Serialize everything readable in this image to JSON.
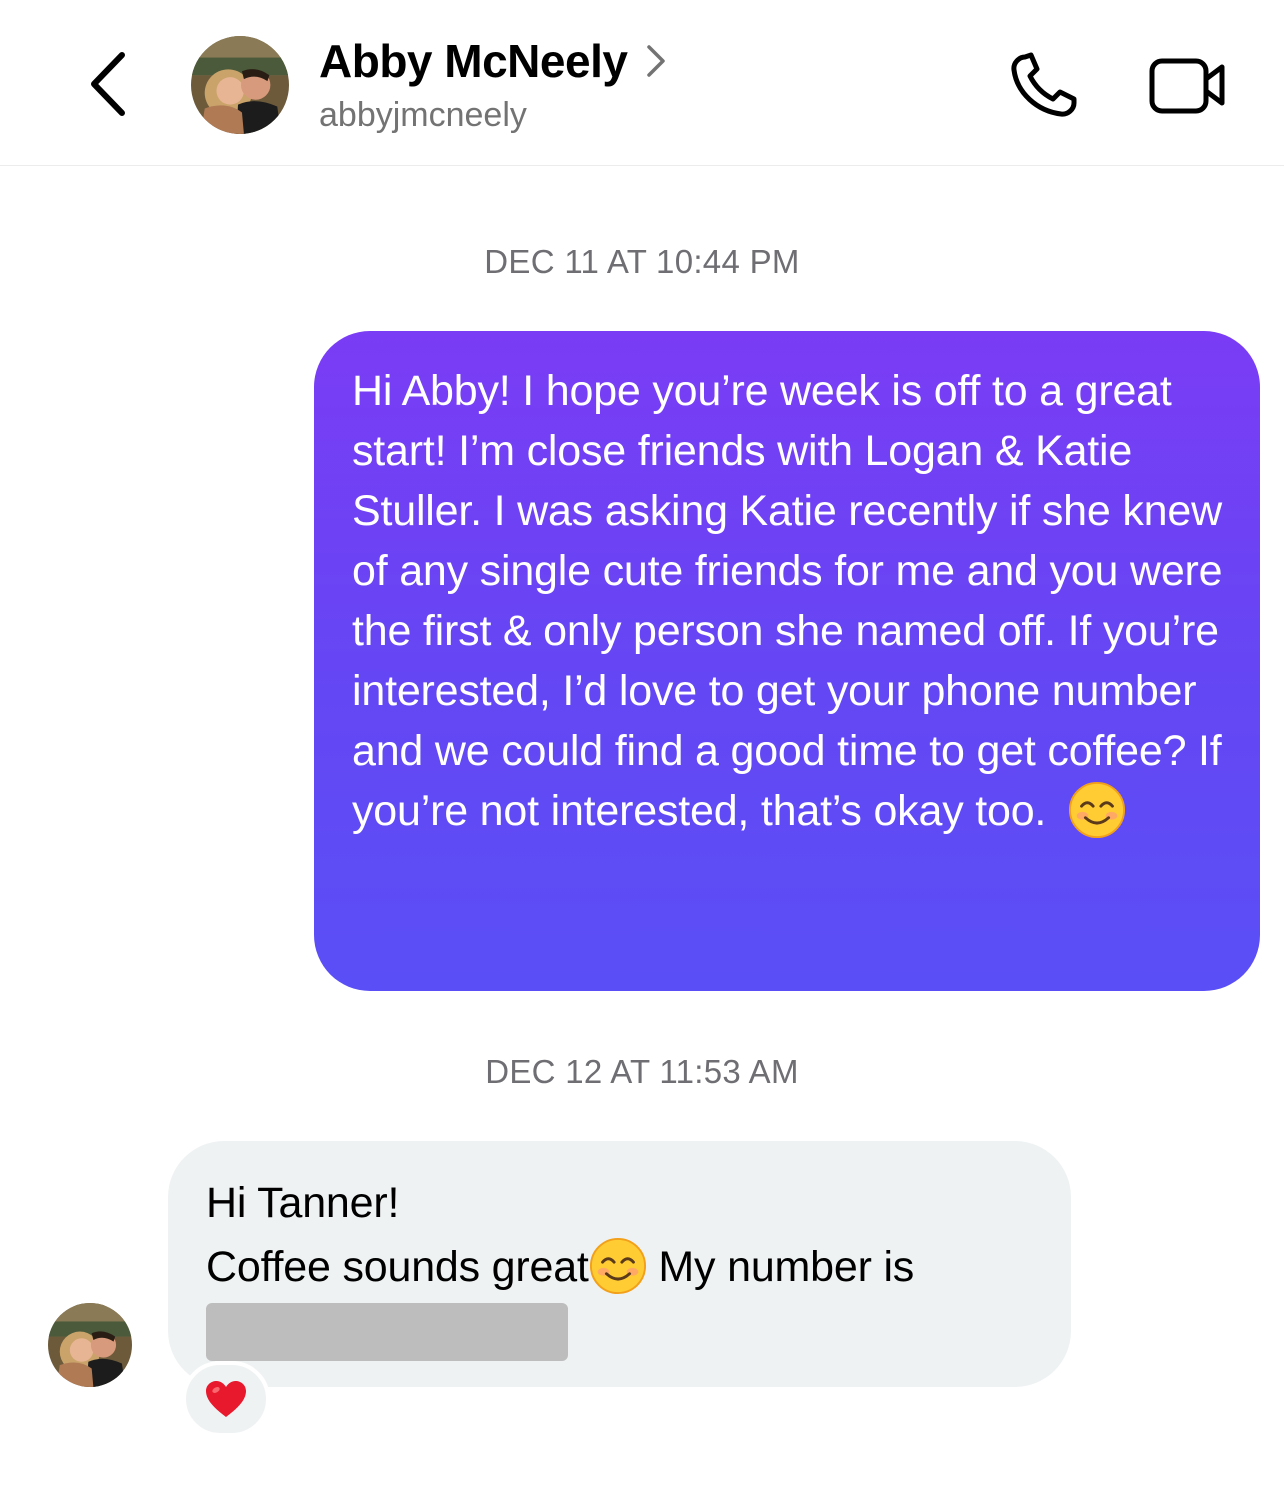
{
  "header": {
    "contact_name": "Abby McNeely",
    "username": "abbyjmcneely",
    "icons": [
      "back-icon",
      "chevron-right-icon",
      "phone-icon",
      "video-camera-icon"
    ]
  },
  "thread": {
    "timestamps": [
      "DEC 11 AT 10:44 PM",
      "DEC 12 AT 11:53 AM"
    ],
    "outgoing_message": "Hi Abby! I hope you’re week is off to a great start! I’m close friends with Logan & Katie Stuller. I was asking Katie recently if she knew of any single cute friends for me and you were the first & only person she named off. If you’re interested, I’d love to get your phone number and we could find a good time to get coffee? If you’re not interested, that’s okay too.",
    "outgoing_emoji": "smiling-face-emoji",
    "incoming_line1": "Hi Tanner!",
    "incoming_line2_part1": "Coffee sounds great",
    "incoming_line2_part2": " My number is",
    "incoming_emoji": "smiling-face-emoji",
    "incoming_redacted": true,
    "reaction": "heart"
  },
  "colors": {
    "outgoing_gradient_top": "#7a3cf5",
    "outgoing_gradient_bottom": "#5a4ff6",
    "incoming_bubble": "#eff2f3",
    "timestamp_text": "#6e6e73",
    "username_text": "#737373",
    "heart": "#e8192c"
  }
}
